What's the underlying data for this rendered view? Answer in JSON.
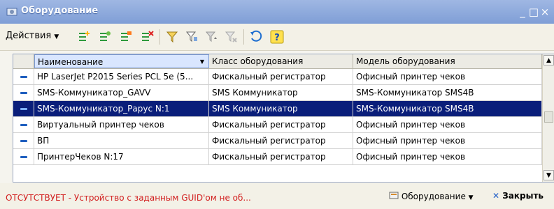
{
  "window": {
    "title": "Оборудование",
    "minimize": "_",
    "maximize": "□",
    "close": "×"
  },
  "toolbar": {
    "actions_label": "Действия"
  },
  "grid": {
    "columns": [
      "Наименование",
      "Класс оборудования",
      "Модель оборудования"
    ],
    "rows": [
      {
        "name": "HP LaserJet P2015 Series PCL 5e (5...",
        "class": "Фискальный регистратор",
        "model": "Офисный принтер чеков",
        "selected": false
      },
      {
        "name": "SMS-Коммуникатор_GAVV",
        "class": "SMS Коммуникатор",
        "model": "SMS-Коммуникатор SMS4B",
        "selected": false
      },
      {
        "name": "SMS-Коммуникатор_Рарус N:1",
        "class": "SMS Коммуникатор",
        "model": "SMS-Коммуникатор SMS4B",
        "selected": true
      },
      {
        "name": "Виртуальный принтер чеков",
        "class": "Фискальный регистратор",
        "model": "Офисный принтер чеков",
        "selected": false
      },
      {
        "name": "ВП",
        "class": "Фискальный регистратор",
        "model": "Офисный принтер чеков",
        "selected": false
      },
      {
        "name": "ПринтерЧеков N:17",
        "class": "Фискальный регистратор",
        "model": "Офисный принтер чеков",
        "selected": false
      }
    ]
  },
  "status": {
    "message": "ОТСУТСТВУЕТ - Устройство с заданным GUID'ом не об...",
    "equipment_button": "Оборудование",
    "close_button": "Закрыть"
  },
  "colors": {
    "selection": "#0a1e7a",
    "status_error": "#d21f1f",
    "titlebar": "#8aa8dc"
  }
}
